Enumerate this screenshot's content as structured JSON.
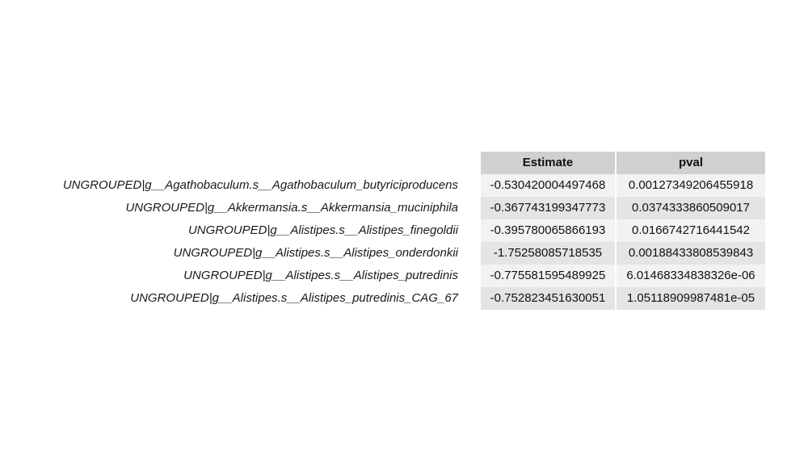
{
  "table": {
    "headers": {
      "estimate": "Estimate",
      "pval": "pval"
    },
    "rows": [
      {
        "label": "UNGROUPED|g__Agathobaculum.s__Agathobaculum_butyriciproducens",
        "estimate": "-0.530420004497468",
        "pval": "0.00127349206455918"
      },
      {
        "label": "UNGROUPED|g__Akkermansia.s__Akkermansia_muciniphila",
        "estimate": "-0.367743199347773",
        "pval": "0.0374333860509017"
      },
      {
        "label": "UNGROUPED|g__Alistipes.s__Alistipes_finegoldii",
        "estimate": "-0.395780065866193",
        "pval": "0.0166742716441542"
      },
      {
        "label": "UNGROUPED|g__Alistipes.s__Alistipes_onderdonkii",
        "estimate": "-1.75258085718535",
        "pval": "0.00188433808539843"
      },
      {
        "label": "UNGROUPED|g__Alistipes.s__Alistipes_putredinis",
        "estimate": "-0.775581595489925",
        "pval": "6.01468334838326e-06"
      },
      {
        "label": "UNGROUPED|g__Alistipes.s__Alistipes_putredinis_CAG_67",
        "estimate": "-0.752823451630051",
        "pval": "1.05118909987481e-05"
      }
    ]
  }
}
